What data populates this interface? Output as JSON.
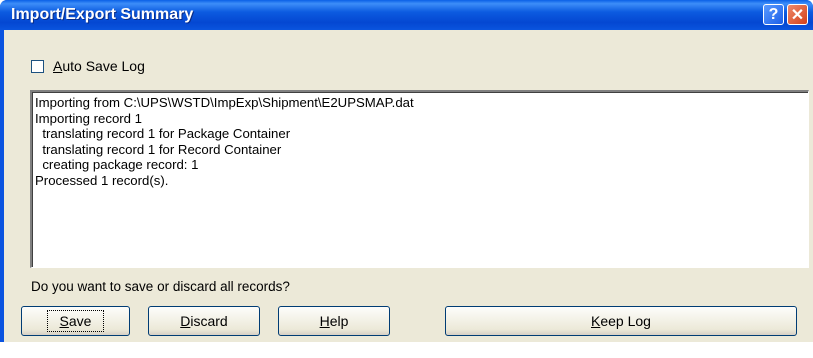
{
  "window": {
    "title": "Import/Export Summary",
    "help_glyph": "?",
    "close_glyph": "✕"
  },
  "auto_save": {
    "label": "Auto Save Log",
    "checked": false
  },
  "log": {
    "lines": [
      "Importing from C:\\UPS\\WSTD\\ImpExp\\Shipment\\E2UPSMAP.dat",
      "Importing record 1",
      "  translating record 1 for Package Container",
      "  translating record 1 for Record Container",
      "  creating package record: 1",
      "Processed 1 record(s)."
    ]
  },
  "prompt": {
    "question": "Do you want to save or discard all records?"
  },
  "buttons": {
    "save_label": "Save",
    "discard_label": "Discard",
    "help_label": "Help",
    "keep_log_label": "Keep Log"
  },
  "colors": {
    "titlebar": "#0a53e0",
    "dialog_face": "#ece9d8",
    "close_button": "#d2401a"
  }
}
